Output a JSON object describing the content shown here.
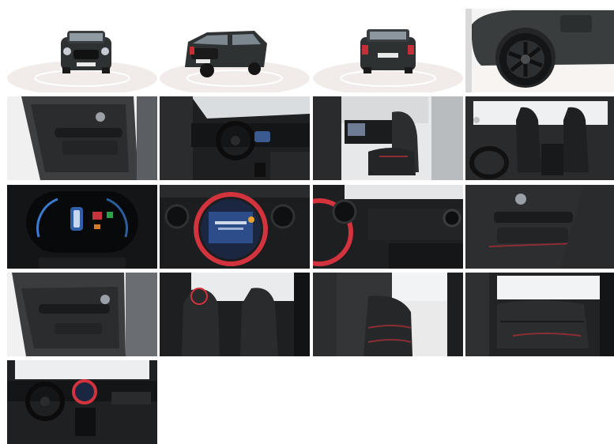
{
  "gallery": {
    "tiles": [
      {
        "id": "photo-front-studio",
        "subject": "car-front-exterior"
      },
      {
        "id": "photo-rear-three-quarter",
        "subject": "car-rear-three-quarter-exterior"
      },
      {
        "id": "photo-rear-studio",
        "subject": "car-rear-exterior"
      },
      {
        "id": "photo-wheel",
        "subject": "front-wheel-closeup"
      },
      {
        "id": "photo-front-door-panel",
        "subject": "driver-door-panel"
      },
      {
        "id": "photo-dashboard-left",
        "subject": "driver-side-dashboard"
      },
      {
        "id": "photo-front-seats-side",
        "subject": "front-seats-side-view"
      },
      {
        "id": "photo-front-seats-rear",
        "subject": "front-seats-from-rear"
      },
      {
        "id": "photo-instrument-cluster",
        "subject": "digital-instrument-cluster"
      },
      {
        "id": "photo-infotainment",
        "subject": "center-infotainment-screen"
      },
      {
        "id": "photo-passenger-dash",
        "subject": "passenger-side-dashboard"
      },
      {
        "id": "photo-passenger-door",
        "subject": "passenger-door-panel"
      },
      {
        "id": "photo-rear-door-panel",
        "subject": "rear-door-panel"
      },
      {
        "id": "photo-rear-seats-back",
        "subject": "seatbacks-and-rear-cabin"
      },
      {
        "id": "photo-rear-seats-side",
        "subject": "rear-bench-side-view"
      },
      {
        "id": "photo-rear-bench",
        "subject": "rear-bench-seat"
      },
      {
        "id": "photo-cockpit-overview",
        "subject": "cockpit-overview"
      }
    ],
    "colors": {
      "background": "#ffffff",
      "studio_floor": "#f2efed",
      "car_body": "#2f3233",
      "interior_dark": "#1c1d1f",
      "seat_fabric": "#2a2a2c",
      "accent_red": "#d2333c",
      "screen_blue": "#2d4d8a"
    }
  }
}
